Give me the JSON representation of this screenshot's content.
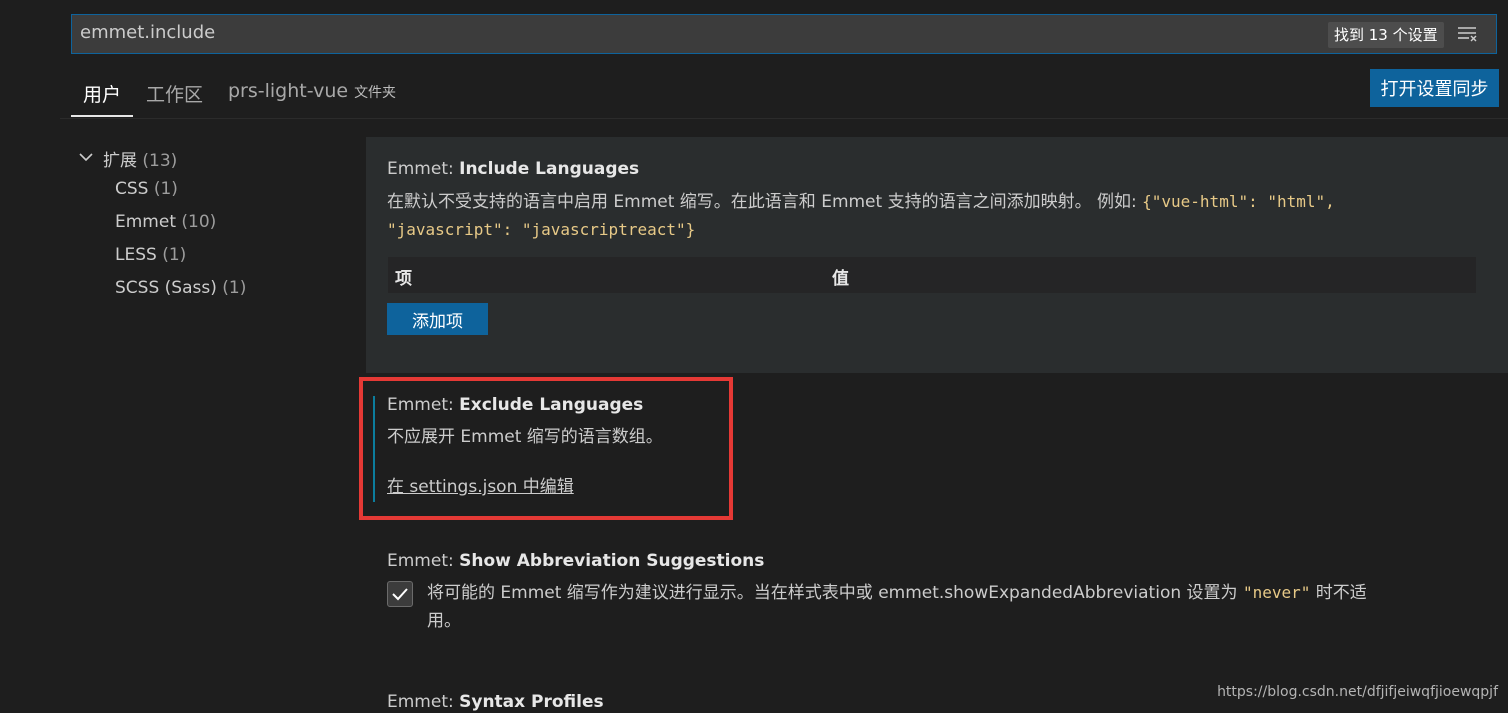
{
  "search": {
    "value": "emmet.include",
    "count_badge": "找到 13 个设置"
  },
  "tabs": [
    {
      "label": "用户"
    },
    {
      "label": "工作区"
    },
    {
      "label": "prs-light-vue",
      "sub": "文件夹"
    }
  ],
  "sync_button": "打开设置同步",
  "tree": {
    "root": {
      "label": "扩展",
      "count": "(13)"
    },
    "items": [
      {
        "label": "CSS",
        "count": "(1)"
      },
      {
        "label": "Emmet",
        "count": "(10)"
      },
      {
        "label": "LESS",
        "count": "(1)"
      },
      {
        "label": "SCSS (Sass)",
        "count": "(1)"
      }
    ]
  },
  "settings": {
    "include": {
      "category": "Emmet: ",
      "name": "Include Languages",
      "desc": "在默认不受支持的语言中启用 Emmet 缩写。在此语言和 Emmet 支持的语言之间添加映射。 例如: ",
      "code1": "{\"vue-html\": \"html\",",
      "code2": "\"javascript\": \"javascriptreact\"}",
      "col_item": "项",
      "col_value": "值",
      "add_button": "添加项"
    },
    "exclude": {
      "category": "Emmet: ",
      "name": "Exclude Languages",
      "desc": "不应展开 Emmet 缩写的语言数组。",
      "link": "在 settings.json 中编辑"
    },
    "suggest": {
      "category": "Emmet: ",
      "name": "Show Abbreviation Suggestions",
      "desc_a": "将可能的 Emmet 缩写作为建议进行显示。当在样式表中或 emmet.showExpandedAbbreviation 设置为 ",
      "code": "\"never\"",
      "desc_b": " 时不适",
      "desc_c": "用。",
      "checked": true
    },
    "syntax": {
      "category": "Emmet: ",
      "name": "Syntax Profiles"
    }
  },
  "watermark": "https://blog.csdn.net/dfjifjeiwqfjioewqpjf",
  "colors": {
    "accent": "#0e639c",
    "highlight_frame": "#e53935",
    "modified_bar": "#0c7d9d"
  },
  "icons": {
    "filter": "filter-icon",
    "chevron": "chevron-down-icon",
    "check": "check-icon"
  }
}
